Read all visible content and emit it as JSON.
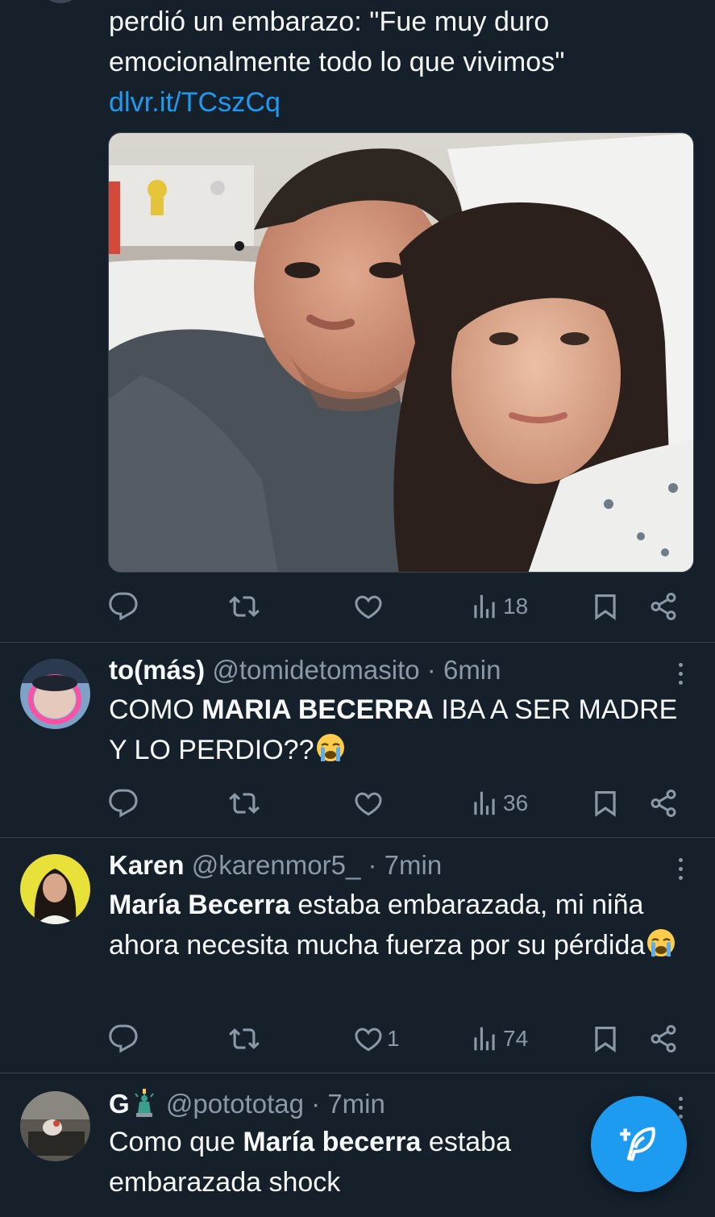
{
  "top_tweet": {
    "text_line1": "perdió un embarazo: \"Fue muy duro",
    "text_line2": "emocionalmente todo lo que vivimos\"",
    "link": "dlvr.it/TCszCq",
    "media_icon": "photo-couple-hospital",
    "stats": {
      "replies": "",
      "retweets": "",
      "likes": "",
      "views": "18"
    }
  },
  "replies": [
    {
      "name": "to(más)",
      "handle": "@tomidetomasito",
      "sep": "·",
      "time": "6min",
      "text_part1": "COMO ",
      "text_bold": "MARIA BECERRA",
      "text_part2": " IBA A SER MADRE Y LO PERDIO??",
      "emoji": "loudly-crying-face",
      "stats": {
        "replies": "",
        "retweets": "",
        "likes": "",
        "views": "36"
      }
    },
    {
      "name": "Karen",
      "handle": "@karenmor5_",
      "sep": "·",
      "time": "7min",
      "text_bold": "María Becerra",
      "text_part2": " estaba embarazada, mi niña ahora necesita mucha fuerza por su pérdida",
      "emoji": "loudly-crying-face",
      "stats": {
        "replies": "",
        "retweets": "",
        "likes": "1",
        "views": "74"
      }
    },
    {
      "name": "G",
      "name_emoji": "statue-of-liberty",
      "handle": "@potototag",
      "sep": "·",
      "time": "7min",
      "text_part1": "Como que ",
      "text_bold": "María becerra",
      "text_part2": " estaba embarazada  shock"
    }
  ],
  "fab": {
    "icon": "compose-feather-plus-icon"
  },
  "colors": {
    "background": "#15202b",
    "accent": "#1d9bf0",
    "muted": "#8b98a5",
    "divider": "#38444d"
  }
}
